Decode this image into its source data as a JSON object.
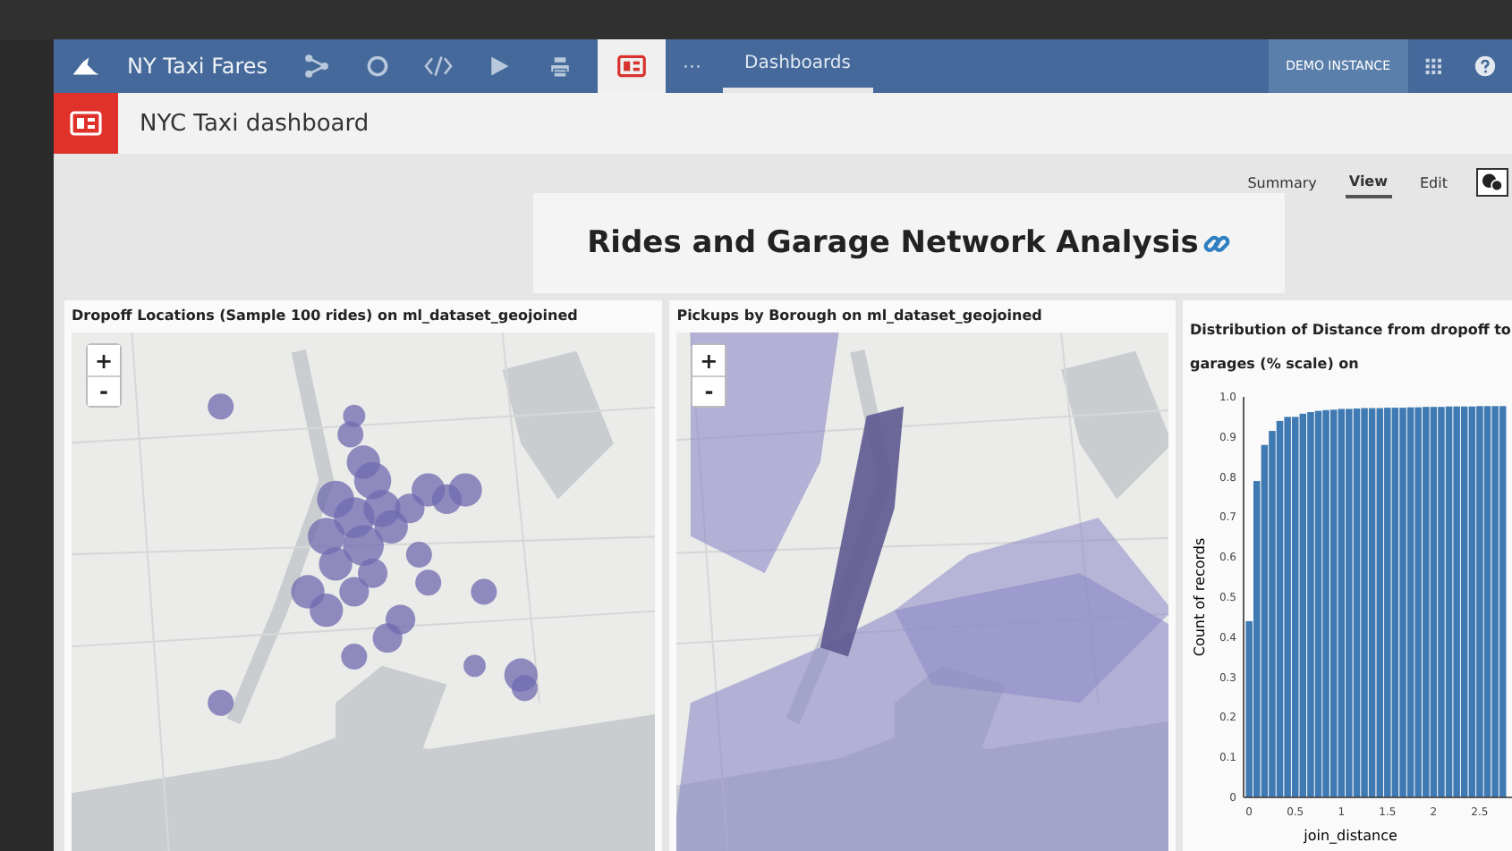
{
  "nav": {
    "project": "NY Taxi Fares",
    "more": "···",
    "tabs": [
      {
        "label": "Dashboards",
        "selected": true
      }
    ],
    "instance": "DEMO INSTANCE"
  },
  "header": {
    "title": "NYC Taxi dashboard"
  },
  "view_tabs": [
    {
      "label": "Summary",
      "selected": false
    },
    {
      "label": "View",
      "selected": true
    },
    {
      "label": "Edit",
      "selected": false
    }
  ],
  "dashboard_title": "Rides and Garage Network Analysis",
  "panels": [
    {
      "kind": "dots_map",
      "title": "Dropoff Locations (Sample 100 rides) on ml_dataset_geojoined",
      "zoom_in": "+",
      "zoom_out": "-"
    },
    {
      "kind": "area_map",
      "title": "Pickups by Borough on ml_dataset_geojoined",
      "zoom_in": "+",
      "zoom_out": "-"
    },
    {
      "kind": "chart",
      "title": "Distribution of Distance from dropoff to garages (% scale) on",
      "chart_data": {
        "type": "bar",
        "xlabel": "join_distance",
        "ylabel": "Count of records",
        "x": [
          0,
          0.083,
          0.167,
          0.25,
          0.333,
          0.417,
          0.5,
          0.583,
          0.667,
          0.75,
          0.833,
          0.917,
          1,
          1.083,
          1.167,
          1.25,
          1.333,
          1.417,
          1.5,
          1.583,
          1.667,
          1.75,
          1.833,
          1.917,
          2,
          2.083,
          2.167,
          2.25,
          2.333,
          2.417,
          2.5,
          2.583,
          2.667,
          2.75
        ],
        "values": [
          0.44,
          0.79,
          0.88,
          0.915,
          0.94,
          0.95,
          0.95,
          0.958,
          0.962,
          0.965,
          0.967,
          0.968,
          0.97,
          0.97,
          0.971,
          0.972,
          0.972,
          0.972,
          0.973,
          0.973,
          0.973,
          0.974,
          0.974,
          0.975,
          0.975,
          0.975,
          0.976,
          0.976,
          0.976,
          0.976,
          0.977,
          0.977,
          0.977,
          0.977
        ],
        "xlim": [
          -0.06,
          2.85
        ],
        "ylim": [
          0,
          1
        ],
        "xticks": [
          0,
          0.5,
          1,
          1.5,
          2,
          2.5
        ],
        "yticks": [
          0,
          0.1,
          0.2,
          0.3,
          0.4,
          0.5,
          0.6,
          0.7,
          0.8,
          0.9,
          {
            "value": 1,
            "label": "1.0"
          }
        ]
      }
    }
  ]
}
